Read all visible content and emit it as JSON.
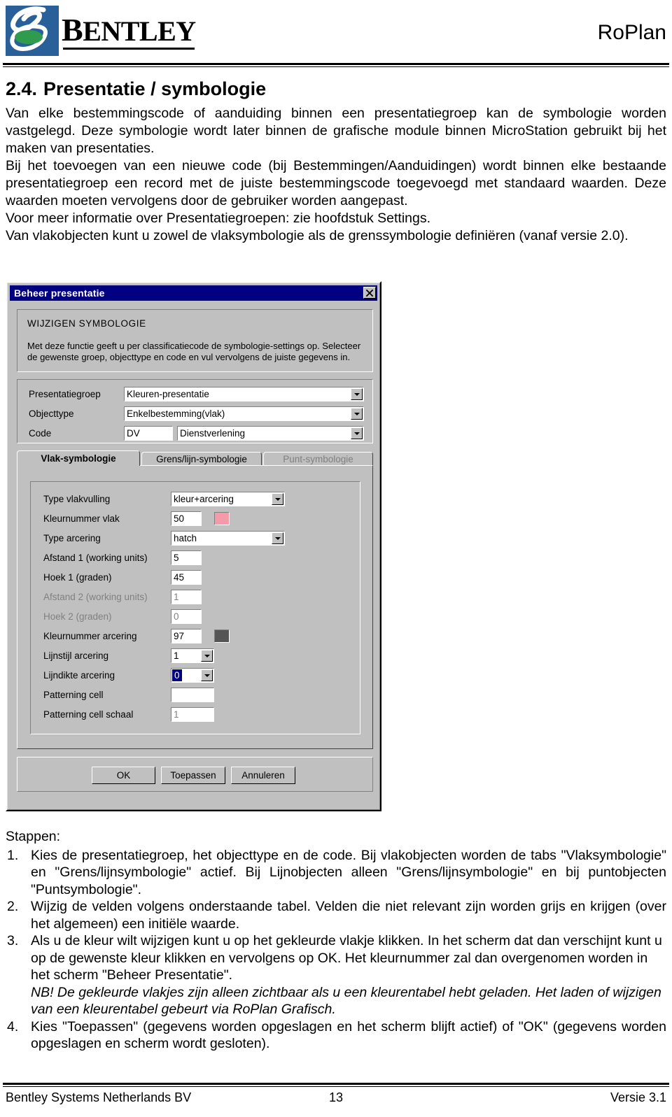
{
  "header": {
    "logo_word_cap": "B",
    "logo_word_rest": "ENTLEY",
    "product": "RoPlan"
  },
  "section": {
    "number": "2.4.",
    "title": "Presentatie / symbologie",
    "paragraphs": [
      "Van elke bestemmingscode of aanduiding binnen een presentatiegroep kan de symbologie worden vastgelegd. Deze symbologie wordt later binnen de grafische module binnen MicroStation gebruikt bij het maken van presentaties.",
      "Bij het toevoegen van een nieuwe code (bij Bestemmingen/Aanduidingen) wordt binnen elke bestaande presentatiegroep een record met de juiste bestemmingscode toegevoegd met standaard waarden. Deze waarden moeten vervolgens door de gebruiker worden aangepast.",
      "Voor meer informatie over Presentatiegroepen: zie hoofdstuk Settings.",
      "Van vlakobjecten kunt u zowel de vlaksymbologie als de grenssymbologie definiëren (vanaf versie 2.0)."
    ]
  },
  "dialog": {
    "title": "Beheer presentatie",
    "close_label": "✕",
    "info": {
      "heading": "WIJZIGEN SYMBOLOGIE",
      "body": "Met deze functie geeft u per classificatiecode de symbologie-settings op. Selecteer de gewenste groep, objecttype en code en vul vervolgens de juiste gegevens in."
    },
    "selectors": [
      {
        "label": "Presentatiegroep",
        "value": "Kleuren-presentatie",
        "type": "combo"
      },
      {
        "label": "Objecttype",
        "value": "Enkelbestemming(vlak)",
        "type": "combo"
      }
    ],
    "code_row": {
      "label": "Code",
      "code_value": "DV",
      "description_value": "Dienstverlening"
    },
    "tabs": [
      {
        "label": "Vlak-symbologie",
        "state": "active"
      },
      {
        "label": "Grens/lijn-symbologie",
        "state": "normal"
      },
      {
        "label": "Punt-symbologie",
        "state": "disabled"
      }
    ],
    "fields": [
      {
        "label": "Type vlakvulling",
        "value": "kleur+arcering",
        "control": "combo",
        "disabled": false,
        "swatch": null
      },
      {
        "label": "Kleurnummer vlak",
        "value": "50",
        "control": "text",
        "disabled": false,
        "swatch": "#f59aa8"
      },
      {
        "label": "Type arcering",
        "value": "hatch",
        "control": "combo",
        "disabled": false,
        "swatch": null
      },
      {
        "label": "Afstand 1 (working units)",
        "value": "5",
        "control": "text",
        "disabled": false,
        "swatch": null
      },
      {
        "label": "Hoek 1 (graden)",
        "value": "45",
        "control": "text",
        "disabled": false,
        "swatch": null
      },
      {
        "label": "Afstand 2 (working units)",
        "value": "1",
        "control": "text",
        "disabled": true,
        "swatch": null
      },
      {
        "label": "Hoek 2 (graden)",
        "value": "0",
        "control": "text",
        "disabled": true,
        "swatch": null
      },
      {
        "label": "Kleurnummer arcering",
        "value": "97",
        "control": "text",
        "disabled": false,
        "swatch": "#555555"
      },
      {
        "label": "Lijnstijl arcering",
        "value": "1",
        "control": "smallcombo",
        "disabled": false,
        "swatch": null
      },
      {
        "label": "Lijndikte arcering",
        "value": "0",
        "control": "focuscombo",
        "disabled": false,
        "swatch": null
      },
      {
        "label": "Patterning cell",
        "value": "",
        "control": "text",
        "disabled": false,
        "swatch": null
      },
      {
        "label": "Patterning cell schaal",
        "value": "1",
        "control": "text",
        "disabled": true,
        "swatch": null
      }
    ],
    "buttons": [
      {
        "label": "OK"
      },
      {
        "label": "Toepassen"
      },
      {
        "label": "Annuleren"
      }
    ],
    "accent_titlebar": "#000080",
    "face_color": "#c0c0c0"
  },
  "steps": {
    "heading": "Stappen:",
    "items": [
      {
        "marker": "1.",
        "text": "Kies de presentatiegroep, het objecttype en de code. Bij vlakobjecten worden de tabs \"Vlaksymbologie\" en \"Grens/lijnsymbologie\" actief. Bij Lijnobjecten alleen \"Grens/lijnsymbologie\" en bij puntobjecten \"Puntsymbologie\"."
      },
      {
        "marker": "2.",
        "text": "Wijzig de velden volgens onderstaande tabel. Velden die niet relevant zijn worden grijs en krijgen (over het algemeen) een initiële waarde."
      },
      {
        "marker": "3.",
        "text": "Als u de kleur wilt wijzigen kunt u op het gekleurde vlakje klikken. In het scherm dat dan verschijnt kunt u op de gewenste kleur klikken en vervolgens op OK. Het kleurnummer zal dan overgenomen worden in het scherm \"Beheer Presentatie\".",
        "note": "NB! De gekleurde vlakjes zijn alleen zichtbaar als u een kleurentabel hebt geladen. Het laden of wijzigen van een kleurentabel gebeurt via RoPlan Grafisch."
      },
      {
        "marker": "4.",
        "text": "Kies \"Toepassen\" (gegevens worden opgeslagen en het scherm blijft actief) of \"OK\" (gegevens worden opgeslagen en scherm wordt gesloten)."
      }
    ]
  },
  "footer": {
    "left": "Bentley Systems Netherlands BV",
    "center": "13",
    "right": "Versie 3.1"
  }
}
